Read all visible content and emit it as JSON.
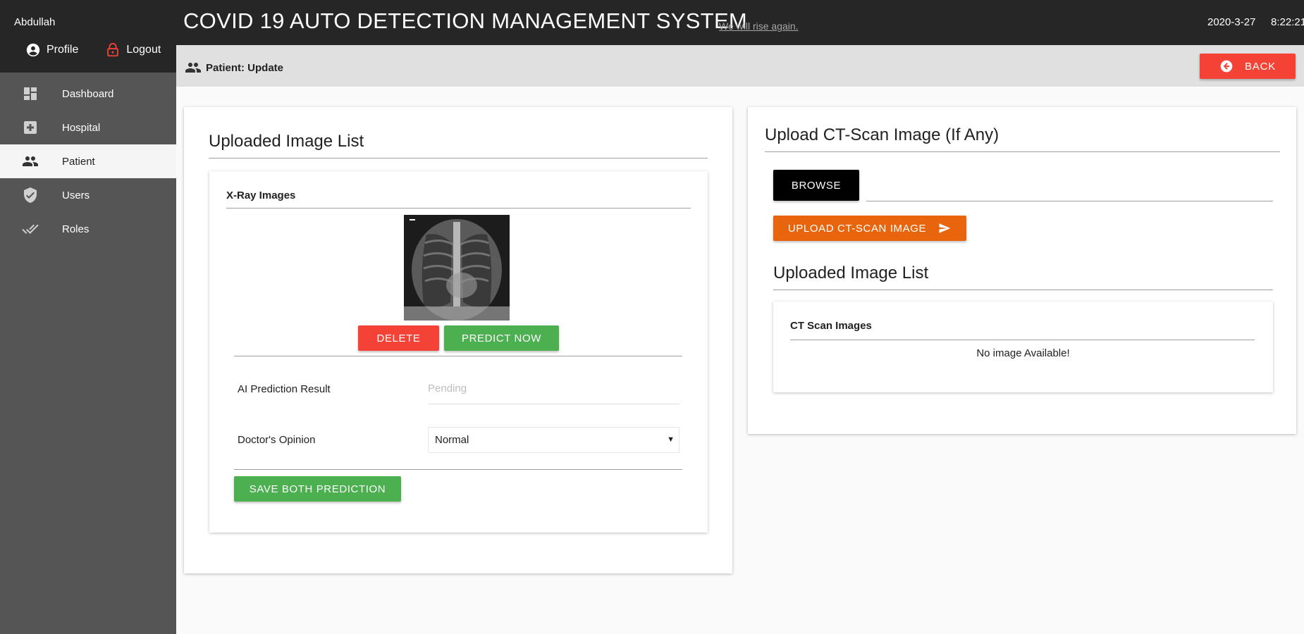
{
  "app": {
    "title": "COVID 19 AUTO DETECTION MANAGEMENT SYSTEM",
    "tagline": "We will rise again.",
    "date": "2020-3-27",
    "time": "8:22:21"
  },
  "sidebar": {
    "user_name": "Abdullah",
    "profile_label": "Profile",
    "logout_label": "Logout",
    "items": [
      {
        "label": "Dashboard",
        "icon": "dashboard-icon"
      },
      {
        "label": "Hospital",
        "icon": "hospital-icon"
      },
      {
        "label": "Patient",
        "icon": "people-icon",
        "active": true
      },
      {
        "label": "Users",
        "icon": "shield-icon"
      },
      {
        "label": "Roles",
        "icon": "double-check-icon"
      }
    ]
  },
  "subheader": {
    "title": "Patient: Update",
    "back_label": "BACK"
  },
  "left_panel": {
    "heading": "Uploaded Image List",
    "xray_title": "X-Ray Images",
    "delete_label": "DELETE",
    "predict_label": "PREDICT NOW",
    "ai_label": "AI Prediction Result",
    "ai_value": "Pending",
    "opinion_label": "Doctor's Opinion",
    "opinion_value": "Normal",
    "save_label": "SAVE BOTH PREDICTION"
  },
  "right_panel": {
    "heading": "Upload CT-Scan Image (If Any)",
    "browse_label": "BROWSE",
    "upload_label": "UPLOAD CT-SCAN IMAGE",
    "list_heading": "Uploaded Image List",
    "ct_title": "CT Scan Images",
    "empty_text": "No image Available!"
  },
  "colors": {
    "dark": "#262626",
    "sidebar": "#555555",
    "red": "#f44336",
    "green": "#4caf50",
    "orange": "#e8650e"
  }
}
